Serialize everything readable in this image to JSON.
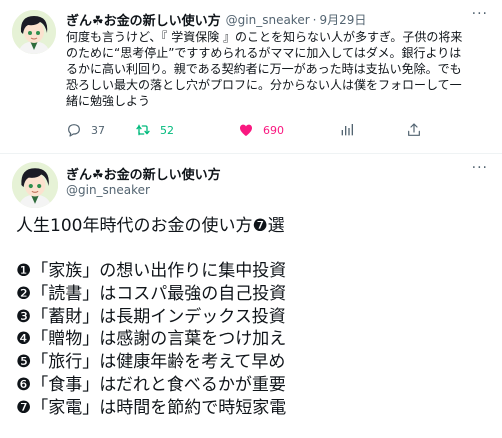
{
  "tweet1": {
    "name": "ぎん☘お金の新しい使い方",
    "handle": "@gin_sneaker",
    "separator": "·",
    "date": "9月29日",
    "more": "···",
    "text_lines": [
      "何度も言うけど、『 学資保険 』のことを知らない人が多すぎ。子供の将来",
      "のために“思考停止”ですすめられるがママに加入してはダメ。銀行よりは",
      "るかに高い利回り。親である契約者に万一があった時は支払い免除。でも",
      "恐ろしい最大の落とし穴がプロフに。分からない人は僕をフォローして一",
      "緒に勉強しよう"
    ],
    "actions": {
      "reply_count": "37",
      "retweet_count": "52",
      "like_count": "690",
      "reply_icon": "reply-icon",
      "retweet_icon": "retweet-icon",
      "like_icon": "heart-icon",
      "stats_icon": "stats-icon",
      "share_icon": "share-icon"
    }
  },
  "tweet2": {
    "name": "ぎん☘お金の新しい使い方",
    "handle": "@gin_sneaker",
    "more": "···",
    "title": "人生100年時代のお金の使い方❼選",
    "list": [
      "❶「家族」の想い出作りに集中投資",
      "❷「読書」はコスパ最強の自己投資",
      "❸「蓄財」は長期インデックス投資",
      "❹「贈物」は感謝の言葉をつけ加え",
      "❺「旅行」は健康年齢を考えて早め",
      "❻「食事」はだれと食べるかが重要",
      "❼「家電」は時間を節約で時短家電"
    ]
  },
  "colors": {
    "text": "#0f1419",
    "secondary": "#536471",
    "retweet": "#00ba7c",
    "like": "#f91880",
    "clover": "#2e9e3a"
  }
}
